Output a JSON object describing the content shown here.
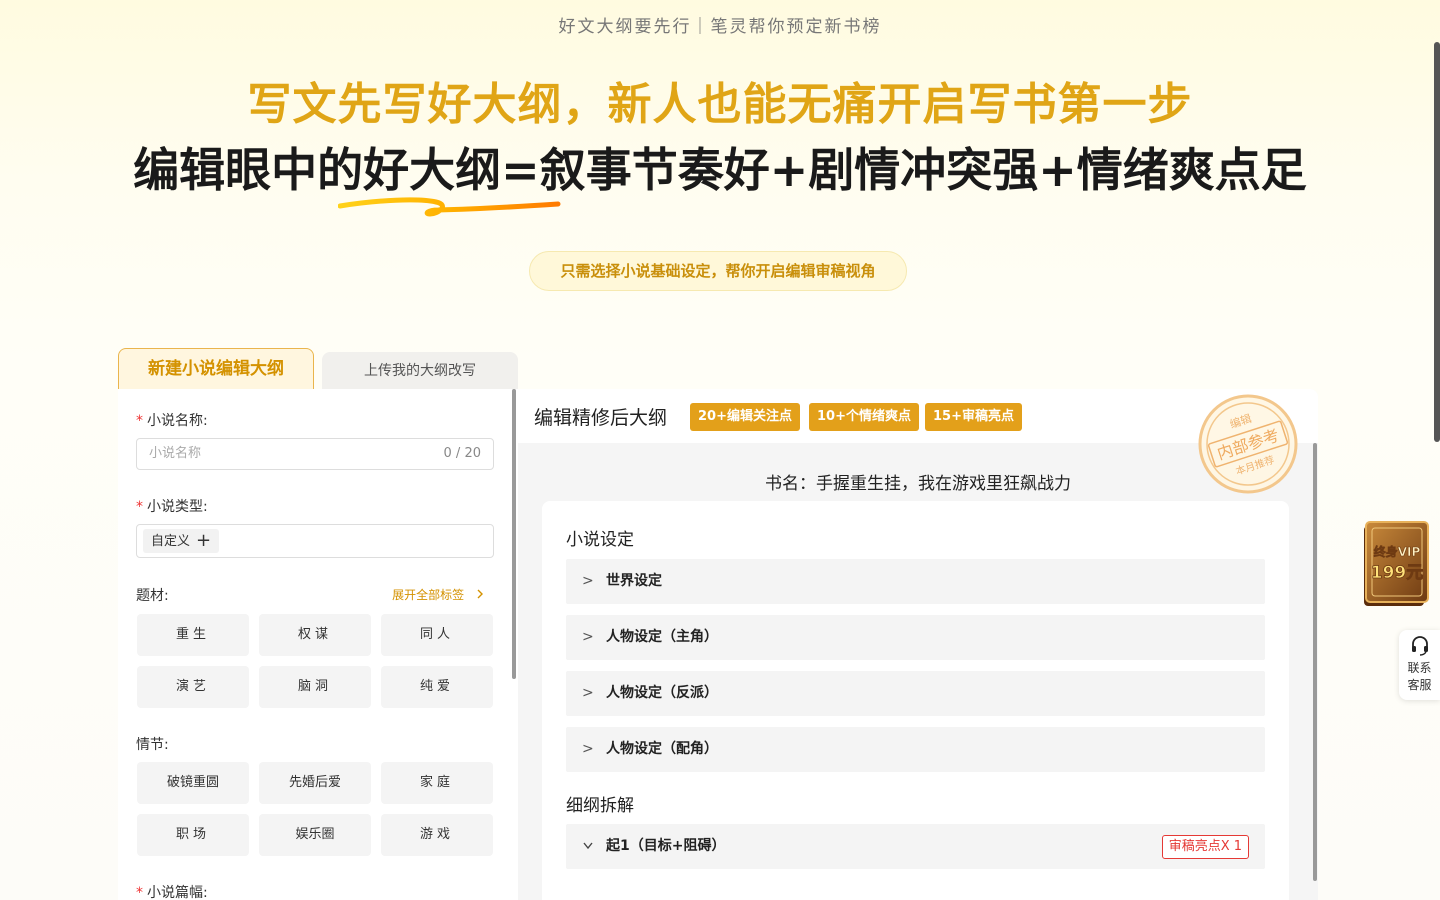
{
  "header": {
    "tagline": "好文大纲要先行｜笔灵帮你预定新书榜",
    "headline_gold": "写文先写好大纲，新人也能无痛开启写书第一步",
    "headline_black": "编辑眼中的好大纲=叙事节奏好+剧情冲突强+情绪爽点足",
    "subtitle": "只需选择小说基础设定，帮你开启编辑审稿视角"
  },
  "tabs": [
    {
      "label": "新建小说编辑大纲",
      "active": true
    },
    {
      "label": "上传我的大纲改写",
      "active": false
    }
  ],
  "form": {
    "name_label": "小说名称:",
    "name_placeholder": "小说名称",
    "name_count": "0 / 20",
    "type_label": "小说类型:",
    "type_chip": "自定义",
    "type_add": "+",
    "theme_label": "题材:",
    "expand_label": "展开全部标签",
    "themes": [
      "重生",
      "权谋",
      "同人",
      "演艺",
      "脑洞",
      "纯爱"
    ],
    "plot_label": "情节:",
    "plots": [
      "破镜重圆",
      "先婚后爱",
      "家庭",
      "职场",
      "娱乐圈",
      "游戏"
    ],
    "length_label": "小说篇幅:"
  },
  "preview": {
    "title": "编辑精修后大纲",
    "badges": [
      "20+编辑关注点",
      "10+个情绪爽点",
      "15+审稿亮点"
    ],
    "stamp_top": "编辑",
    "stamp_main": "内部参考",
    "stamp_bottom": "本月推荐",
    "book_name": "书名：手握重生挂，我在游戏里狂飙战力",
    "settings_title": "小说设定",
    "settings": [
      "世界设定",
      "人物设定（主角）",
      "人物设定（反派）",
      "人物设定（配角）"
    ],
    "outline_title": "细纲拆解",
    "outline_items": [
      {
        "label": "起1（目标+阻碍）",
        "tag": "审稿亮点X 1",
        "expanded": true
      }
    ]
  },
  "side": {
    "vip_line1": "终身VIP",
    "vip_line2": "199元",
    "service_line1": "联系",
    "service_line2": "客服"
  },
  "colors": {
    "accent_gold": "#e0a516",
    "badge_gold": "#e3a01a",
    "highlight_red": "#e53935"
  }
}
